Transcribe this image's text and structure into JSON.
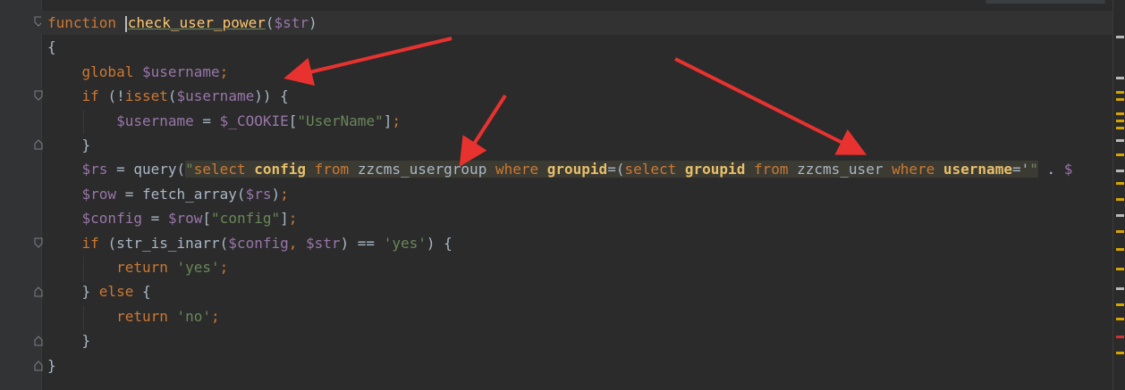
{
  "editor": {
    "lines": [
      {
        "tokens": [
          [
            "kw",
            "function "
          ],
          [
            "func-name",
            "check_user_power"
          ],
          [
            "fn",
            "("
          ],
          [
            "var",
            "$str"
          ],
          [
            "fn",
            ")"
          ]
        ]
      },
      {
        "tokens": [
          [
            "fn",
            "{"
          ]
        ]
      },
      {
        "tokens": [
          [
            "fn",
            "    "
          ],
          [
            "kw",
            "global "
          ],
          [
            "var",
            "$username"
          ],
          [
            "kw",
            ";"
          ]
        ]
      },
      {
        "tokens": [
          [
            "fn",
            "    "
          ],
          [
            "kw",
            "if "
          ],
          [
            "fn",
            "(!"
          ],
          [
            "kw",
            "isset"
          ],
          [
            "fn",
            "("
          ],
          [
            "var",
            "$username"
          ],
          [
            "fn",
            ")) {"
          ]
        ]
      },
      {
        "tokens": [
          [
            "fn",
            "        "
          ],
          [
            "var",
            "$username"
          ],
          [
            "fn",
            " = "
          ],
          [
            "var",
            "$_COOKIE"
          ],
          [
            "fn",
            "["
          ],
          [
            "str",
            "\"UserName\""
          ],
          [
            "fn",
            "]"
          ],
          [
            "kw",
            ";"
          ]
        ]
      },
      {
        "tokens": [
          [
            "fn",
            "    }"
          ]
        ]
      },
      {
        "tokens": [
          [
            "fn",
            "    "
          ],
          [
            "var",
            "$rs"
          ],
          [
            "fn",
            " = query("
          ],
          [
            "str",
            "\""
          ],
          [
            "sql-kw",
            "select "
          ],
          [
            "sql-col",
            "config "
          ],
          [
            "sql-kw",
            "from "
          ],
          [
            "sql-id",
            "zzcms_usergroup "
          ],
          [
            "sql-kw",
            "where "
          ],
          [
            "sql-col",
            "groupid"
          ],
          [
            "sql-id",
            "=("
          ],
          [
            "sql-kw",
            "select "
          ],
          [
            "sql-col",
            "groupid "
          ],
          [
            "sql-kw",
            "from "
          ],
          [
            "sql-id",
            "zzcms_user "
          ],
          [
            "sql-kw",
            "where "
          ],
          [
            "sql-col",
            "username"
          ],
          [
            "sql-id",
            "='"
          ],
          [
            "str",
            "\""
          ],
          [
            "fn",
            " . "
          ],
          [
            "var",
            "$"
          ]
        ]
      },
      {
        "tokens": [
          [
            "fn",
            "    "
          ],
          [
            "var",
            "$row"
          ],
          [
            "fn",
            " = fetch_array("
          ],
          [
            "var",
            "$rs"
          ],
          [
            "fn",
            ")"
          ],
          [
            "kw",
            ";"
          ]
        ]
      },
      {
        "tokens": [
          [
            "fn",
            "    "
          ],
          [
            "var",
            "$config"
          ],
          [
            "fn",
            " = "
          ],
          [
            "var",
            "$row"
          ],
          [
            "fn",
            "["
          ],
          [
            "str",
            "\"config\""
          ],
          [
            "fn",
            "]"
          ],
          [
            "kw",
            ";"
          ]
        ]
      },
      {
        "tokens": [
          [
            "fn",
            "    "
          ],
          [
            "kw",
            "if "
          ],
          [
            "fn",
            "(str_is_inarr("
          ],
          [
            "var",
            "$config"
          ],
          [
            "kw",
            ", "
          ],
          [
            "var",
            "$str"
          ],
          [
            "fn",
            ") == "
          ],
          [
            "str",
            "'yes'"
          ],
          [
            "fn",
            ") {"
          ]
        ]
      },
      {
        "tokens": [
          [
            "fn",
            "        "
          ],
          [
            "kw",
            "return "
          ],
          [
            "str",
            "'yes'"
          ],
          [
            "kw",
            ";"
          ]
        ]
      },
      {
        "tokens": [
          [
            "fn",
            "    } "
          ],
          [
            "kw",
            "else "
          ],
          [
            "fn",
            "{"
          ]
        ]
      },
      {
        "tokens": [
          [
            "fn",
            "        "
          ],
          [
            "kw",
            "return "
          ],
          [
            "str",
            "'no'"
          ],
          [
            "kw",
            ";"
          ]
        ]
      },
      {
        "tokens": [
          [
            "fn",
            "    }"
          ]
        ]
      },
      {
        "tokens": [
          [
            "fn",
            "}"
          ]
        ]
      }
    ]
  },
  "colors": {
    "background": "#2b2b2b",
    "keyword": "#cc7832",
    "variable": "#9876aa",
    "string": "#6a8759",
    "function_name": "#ffc66d",
    "annotation_arrow": "#e8322f"
  },
  "icons": {
    "fold_marker": "fold-marker-icon",
    "arrow": "annotation-arrow"
  }
}
